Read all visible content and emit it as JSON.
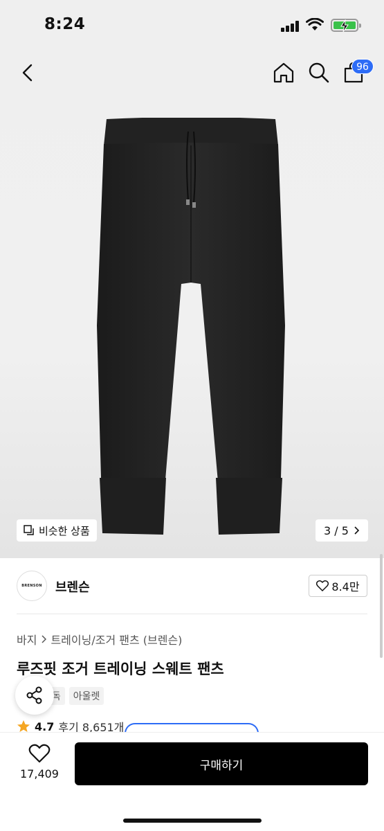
{
  "status_bar": {
    "time": "8:24"
  },
  "header": {
    "cart_count": "96"
  },
  "gallery": {
    "similar_label": "비슷한 상품",
    "pager": "3 / 5"
  },
  "brand": {
    "logo_text": "BRENSON",
    "name": "브렌슨",
    "likes": "8.4만"
  },
  "breadcrumb": {
    "category": "바지",
    "subcategory": "트레이닝/조거 팬츠 (브렌슨)"
  },
  "product": {
    "title": "루즈핏 조거 트레이닝 스웨트 팬츠",
    "tags": [
      "단독",
      "아울렛"
    ],
    "rating": "4.7",
    "reviews": "후기 8,651개"
  },
  "bottom_bar": {
    "wish_count": "17,409",
    "buy_label": "구매하기"
  },
  "colors": {
    "accent": "#2d6cf6",
    "buy_button": "#000000",
    "star": "#f5a623"
  }
}
